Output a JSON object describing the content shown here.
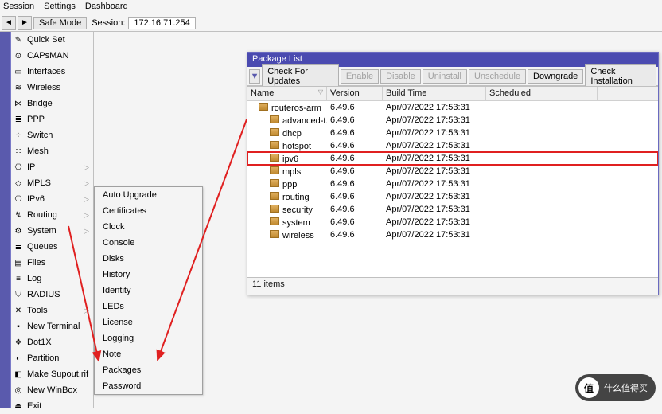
{
  "menubar": [
    "Session",
    "Settings",
    "Dashboard"
  ],
  "toolbar": {
    "back_icon": "◄",
    "fwd_icon": "►",
    "safe_mode": "Safe Mode",
    "session_lbl": "Session:",
    "session_val": "172.16.71.254"
  },
  "sidebar": [
    {
      "icon": "✎",
      "label": "Quick Set",
      "name": "quick-set"
    },
    {
      "icon": "⊙",
      "label": "CAPsMAN",
      "name": "capsman"
    },
    {
      "icon": "▭",
      "label": "Interfaces",
      "name": "interfaces"
    },
    {
      "icon": "≋",
      "label": "Wireless",
      "name": "wireless"
    },
    {
      "icon": "⋈",
      "label": "Bridge",
      "name": "bridge"
    },
    {
      "icon": "≣",
      "label": "PPP",
      "name": "ppp"
    },
    {
      "icon": "⁘",
      "label": "Switch",
      "name": "switch"
    },
    {
      "icon": "∷",
      "label": "Mesh",
      "name": "mesh"
    },
    {
      "icon": "⎔",
      "label": "IP",
      "name": "ip",
      "chev": true
    },
    {
      "icon": "◇",
      "label": "MPLS",
      "name": "mpls",
      "chev": true
    },
    {
      "icon": "⎔",
      "label": "IPv6",
      "name": "ipv6",
      "chev": true
    },
    {
      "icon": "↯",
      "label": "Routing",
      "name": "routing",
      "chev": true
    },
    {
      "icon": "⚙",
      "label": "System",
      "name": "system",
      "chev": true
    },
    {
      "icon": "≣",
      "label": "Queues",
      "name": "queues"
    },
    {
      "icon": "▤",
      "label": "Files",
      "name": "files"
    },
    {
      "icon": "≡",
      "label": "Log",
      "name": "log"
    },
    {
      "icon": "⛉",
      "label": "RADIUS",
      "name": "radius"
    },
    {
      "icon": "✕",
      "label": "Tools",
      "name": "tools",
      "chev": true
    },
    {
      "icon": "▪",
      "label": "New Terminal",
      "name": "new-terminal"
    },
    {
      "icon": "❖",
      "label": "Dot1X",
      "name": "dot1x"
    },
    {
      "icon": "◐",
      "label": "Partition",
      "name": "partition"
    },
    {
      "icon": "◧",
      "label": "Make Supout.rif",
      "name": "make-supout"
    },
    {
      "icon": "◎",
      "label": "New WinBox",
      "name": "new-winbox"
    },
    {
      "icon": "⏏",
      "label": "Exit",
      "name": "exit"
    }
  ],
  "submenu": [
    "Auto Upgrade",
    "Certificates",
    "Clock",
    "Console",
    "Disks",
    "History",
    "Identity",
    "LEDs",
    "License",
    "Logging",
    "Note",
    "Packages",
    "Password"
  ],
  "window": {
    "title": "Package List",
    "buttons": {
      "updates": "Check For Updates",
      "enable": "Enable",
      "disable": "Disable",
      "uninstall": "Uninstall",
      "unschedule": "Unschedule",
      "downgrade": "Downgrade",
      "check_inst": "Check Installation"
    },
    "columns": [
      "Name",
      "Version",
      "Build Time",
      "Scheduled"
    ],
    "rows": [
      {
        "name": "routeros-arm",
        "version": "6.49.6",
        "build": "Apr/07/2022 17:53:31",
        "indent": 1
      },
      {
        "name": "advanced-t...",
        "version": "6.49.6",
        "build": "Apr/07/2022 17:53:31",
        "indent": 2
      },
      {
        "name": "dhcp",
        "version": "6.49.6",
        "build": "Apr/07/2022 17:53:31",
        "indent": 2
      },
      {
        "name": "hotspot",
        "version": "6.49.6",
        "build": "Apr/07/2022 17:53:31",
        "indent": 2
      },
      {
        "name": "ipv6",
        "version": "6.49.6",
        "build": "Apr/07/2022 17:53:31",
        "indent": 2,
        "hl": true
      },
      {
        "name": "mpls",
        "version": "6.49.6",
        "build": "Apr/07/2022 17:53:31",
        "indent": 2
      },
      {
        "name": "ppp",
        "version": "6.49.6",
        "build": "Apr/07/2022 17:53:31",
        "indent": 2
      },
      {
        "name": "routing",
        "version": "6.49.6",
        "build": "Apr/07/2022 17:53:31",
        "indent": 2
      },
      {
        "name": "security",
        "version": "6.49.6",
        "build": "Apr/07/2022 17:53:31",
        "indent": 2
      },
      {
        "name": "system",
        "version": "6.49.6",
        "build": "Apr/07/2022 17:53:31",
        "indent": 2
      },
      {
        "name": "wireless",
        "version": "6.49.6",
        "build": "Apr/07/2022 17:53:31",
        "indent": 2
      }
    ],
    "footer": "11 items"
  },
  "watermark": "什么值得买"
}
